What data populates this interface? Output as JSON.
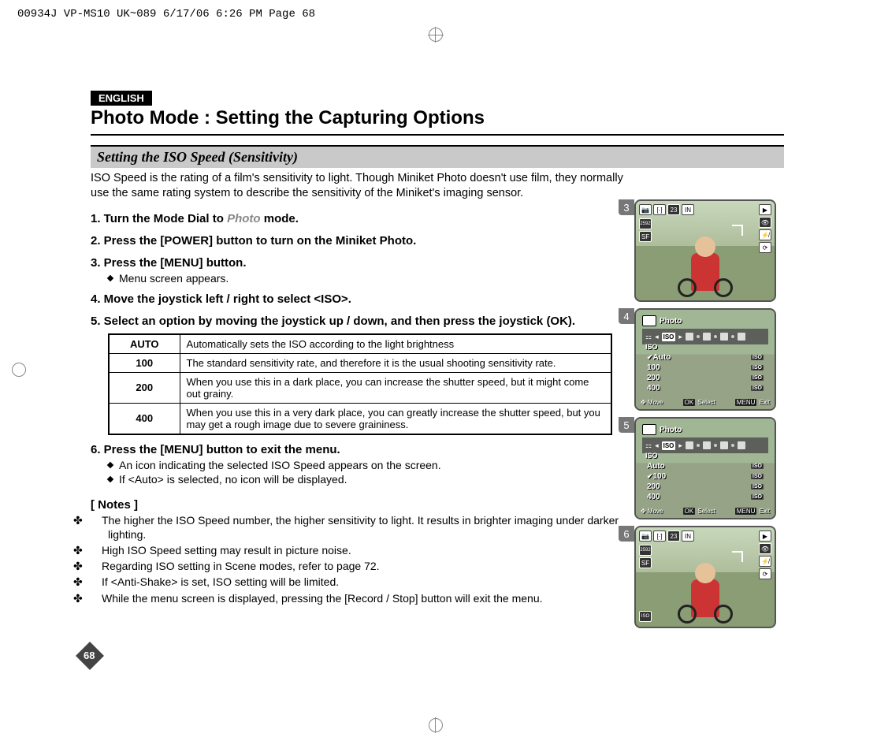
{
  "print_header": "00934J VP-MS10 UK~089  6/17/06 6:26 PM  Page 68",
  "lang_tag": "ENGLISH",
  "main_title": "Photo Mode : Setting the Capturing Options",
  "subtitle": "Setting the ISO Speed (Sensitivity)",
  "intro": "ISO Speed is the rating of a film's sensitivity to light. Though Miniket Photo doesn't use film, they normally use the same rating system to describe the sensitivity of the Miniket's imaging sensor.",
  "steps": {
    "s1_pre": "1. Turn the Mode Dial to ",
    "s1_word": "Photo",
    "s1_post": " mode.",
    "s2": "2. Press the [POWER] button to turn on the Miniket Photo.",
    "s3": "3. Press the [MENU] button.",
    "s3_sub": "Menu screen appears.",
    "s4": "4. Move the joystick left / right to select <ISO>.",
    "s5": "5. Select an option by moving the joystick up / down, and then press the joystick (OK).",
    "s6": "6. Press the [MENU] button to exit the menu.",
    "s6_sub1": "An icon indicating the selected ISO Speed appears on the screen.",
    "s6_sub2": "If <Auto> is selected, no icon will be displayed."
  },
  "iso_table": [
    {
      "k": "AUTO",
      "v": "Automatically sets the ISO according to the light brightness"
    },
    {
      "k": "100",
      "v": "The standard sensitivity rate, and therefore it is the usual shooting sensitivity rate."
    },
    {
      "k": "200",
      "v": "When you use this in a dark place, you can increase the shutter speed, but it might come out grainy."
    },
    {
      "k": "400",
      "v": "When you use this in a very dark place, you can greatly increase the shutter speed, but you may get a rough image due to severe graininess."
    }
  ],
  "notes_head": "[ Notes ]",
  "notes": [
    "The higher the ISO Speed number, the higher sensitivity to light. It results in brighter imaging under darker lighting.",
    "High ISO Speed setting may result in picture noise.",
    "Regarding ISO setting in Scene modes, refer to page 72.",
    "If <Anti-Shake> is set, ISO setting will be limited.",
    "While the menu screen is displayed, pressing the [Record / Stop] button will exit the menu."
  ],
  "page_number": "68",
  "screens": {
    "nums": [
      "3",
      "4",
      "5",
      "6"
    ],
    "counter": "23",
    "mem": "IN",
    "size": "2592",
    "qual": "SF",
    "menu_title": "Photo",
    "menu_tab": "ISO",
    "menu_sublabel": "ISO",
    "items4": [
      "Auto",
      "100",
      "200",
      "400"
    ],
    "selected4": "Auto",
    "items5": [
      "Auto",
      "100",
      "200",
      "400"
    ],
    "selected5": "100",
    "foot_move": "Move",
    "foot_ok": "OK",
    "foot_select": "Select",
    "foot_menu": "MENU",
    "foot_exit": "Exit",
    "iso_badge": "ISO",
    "iso100": "100"
  }
}
